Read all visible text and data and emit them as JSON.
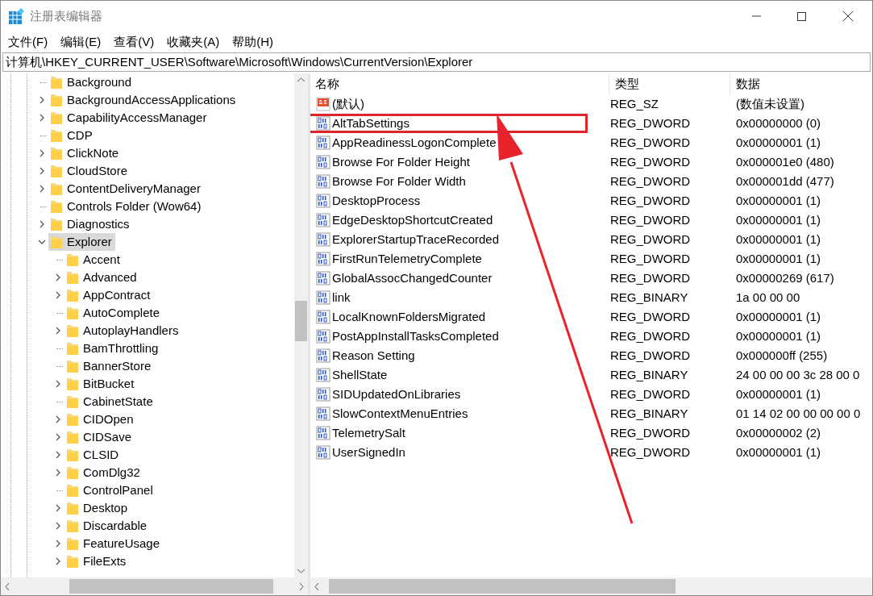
{
  "window": {
    "title": "注册表编辑器"
  },
  "menu": [
    "文件(F)",
    "编辑(E)",
    "查看(V)",
    "收藏夹(A)",
    "帮助(H)"
  ],
  "address": "计算机\\HKEY_CURRENT_USER\\Software\\Microsoft\\Windows\\CurrentVersion\\Explorer",
  "tree": [
    {
      "kind": "leaf",
      "label": "Background",
      "selected": false
    },
    {
      "kind": "branch",
      "label": "BackgroundAccessApplications",
      "expanded": false,
      "selected": false
    },
    {
      "kind": "branch",
      "label": "CapabilityAccessManager",
      "expanded": false,
      "selected": false
    },
    {
      "kind": "leaf",
      "label": "CDP",
      "selected": false
    },
    {
      "kind": "branch",
      "label": "ClickNote",
      "expanded": false,
      "selected": false
    },
    {
      "kind": "branch",
      "label": "CloudStore",
      "expanded": false,
      "selected": false
    },
    {
      "kind": "branch",
      "label": "ContentDeliveryManager",
      "expanded": false,
      "selected": false
    },
    {
      "kind": "leaf",
      "label": "Controls Folder (Wow64)",
      "selected": false
    },
    {
      "kind": "branch",
      "label": "Diagnostics",
      "expanded": false,
      "selected": false
    },
    {
      "kind": "branch",
      "label": "Explorer",
      "expanded": true,
      "selected": true,
      "children": [
        {
          "kind": "leaf",
          "label": "Accent",
          "selected": false
        },
        {
          "kind": "branch",
          "label": "Advanced",
          "expanded": false,
          "selected": false
        },
        {
          "kind": "branch",
          "label": "AppContract",
          "expanded": false,
          "selected": false
        },
        {
          "kind": "leaf",
          "label": "AutoComplete",
          "selected": false
        },
        {
          "kind": "branch",
          "label": "AutoplayHandlers",
          "expanded": false,
          "selected": false
        },
        {
          "kind": "leaf",
          "label": "BamThrottling",
          "selected": false
        },
        {
          "kind": "leaf",
          "label": "BannerStore",
          "selected": false
        },
        {
          "kind": "branch",
          "label": "BitBucket",
          "expanded": false,
          "selected": false
        },
        {
          "kind": "leaf",
          "label": "CabinetState",
          "selected": false
        },
        {
          "kind": "branch",
          "label": "CIDOpen",
          "expanded": false,
          "selected": false
        },
        {
          "kind": "branch",
          "label": "CIDSave",
          "expanded": false,
          "selected": false
        },
        {
          "kind": "branch",
          "label": "CLSID",
          "expanded": false,
          "selected": false
        },
        {
          "kind": "branch",
          "label": "ComDlg32",
          "expanded": false,
          "selected": false
        },
        {
          "kind": "leaf",
          "label": "ControlPanel",
          "selected": false
        },
        {
          "kind": "branch",
          "label": "Desktop",
          "expanded": false,
          "selected": false
        },
        {
          "kind": "branch",
          "label": "Discardable",
          "expanded": false,
          "selected": false
        },
        {
          "kind": "branch",
          "label": "FeatureUsage",
          "expanded": false,
          "selected": false
        },
        {
          "kind": "branch",
          "label": "FileExts",
          "expanded": false,
          "selected": false
        }
      ]
    }
  ],
  "columns": [
    "名称",
    "类型",
    "数据"
  ],
  "values": [
    {
      "kind": "string",
      "name": "(默认)",
      "type": "REG_SZ",
      "data": "(数值未设置)",
      "highlighted": false
    },
    {
      "kind": "binary",
      "name": "AltTabSettings",
      "type": "REG_DWORD",
      "data": "0x00000000 (0)",
      "highlighted": true
    },
    {
      "kind": "binary",
      "name": "AppReadinessLogonComplete",
      "type": "REG_DWORD",
      "data": "0x00000001 (1)",
      "highlighted": false
    },
    {
      "kind": "binary",
      "name": "Browse For Folder Height",
      "type": "REG_DWORD",
      "data": "0x000001e0 (480)",
      "highlighted": false
    },
    {
      "kind": "binary",
      "name": "Browse For Folder Width",
      "type": "REG_DWORD",
      "data": "0x000001dd (477)",
      "highlighted": false
    },
    {
      "kind": "binary",
      "name": "DesktopProcess",
      "type": "REG_DWORD",
      "data": "0x00000001 (1)",
      "highlighted": false
    },
    {
      "kind": "binary",
      "name": "EdgeDesktopShortcutCreated",
      "type": "REG_DWORD",
      "data": "0x00000001 (1)",
      "highlighted": false
    },
    {
      "kind": "binary",
      "name": "ExplorerStartupTraceRecorded",
      "type": "REG_DWORD",
      "data": "0x00000001 (1)",
      "highlighted": false
    },
    {
      "kind": "binary",
      "name": "FirstRunTelemetryComplete",
      "type": "REG_DWORD",
      "data": "0x00000001 (1)",
      "highlighted": false
    },
    {
      "kind": "binary",
      "name": "GlobalAssocChangedCounter",
      "type": "REG_DWORD",
      "data": "0x00000269 (617)",
      "highlighted": false
    },
    {
      "kind": "binary",
      "name": "link",
      "type": "REG_BINARY",
      "data": "1a 00 00 00",
      "highlighted": false
    },
    {
      "kind": "binary",
      "name": "LocalKnownFoldersMigrated",
      "type": "REG_DWORD",
      "data": "0x00000001 (1)",
      "highlighted": false
    },
    {
      "kind": "binary",
      "name": "PostAppInstallTasksCompleted",
      "type": "REG_DWORD",
      "data": "0x00000001 (1)",
      "highlighted": false
    },
    {
      "kind": "binary",
      "name": "Reason Setting",
      "type": "REG_DWORD",
      "data": "0x000000ff (255)",
      "highlighted": false
    },
    {
      "kind": "binary",
      "name": "ShellState",
      "type": "REG_BINARY",
      "data": "24 00 00 00 3c 28 00 0",
      "highlighted": false
    },
    {
      "kind": "binary",
      "name": "SIDUpdatedOnLibraries",
      "type": "REG_DWORD",
      "data": "0x00000001 (1)",
      "highlighted": false
    },
    {
      "kind": "binary",
      "name": "SlowContextMenuEntries",
      "type": "REG_BINARY",
      "data": "01 14 02 00 00 00 00 0",
      "highlighted": false
    },
    {
      "kind": "binary",
      "name": "TelemetrySalt",
      "type": "REG_DWORD",
      "data": "0x00000002 (2)",
      "highlighted": false
    },
    {
      "kind": "binary",
      "name": "UserSignedIn",
      "type": "REG_DWORD",
      "data": "0x00000001 (1)",
      "highlighted": false
    }
  ]
}
